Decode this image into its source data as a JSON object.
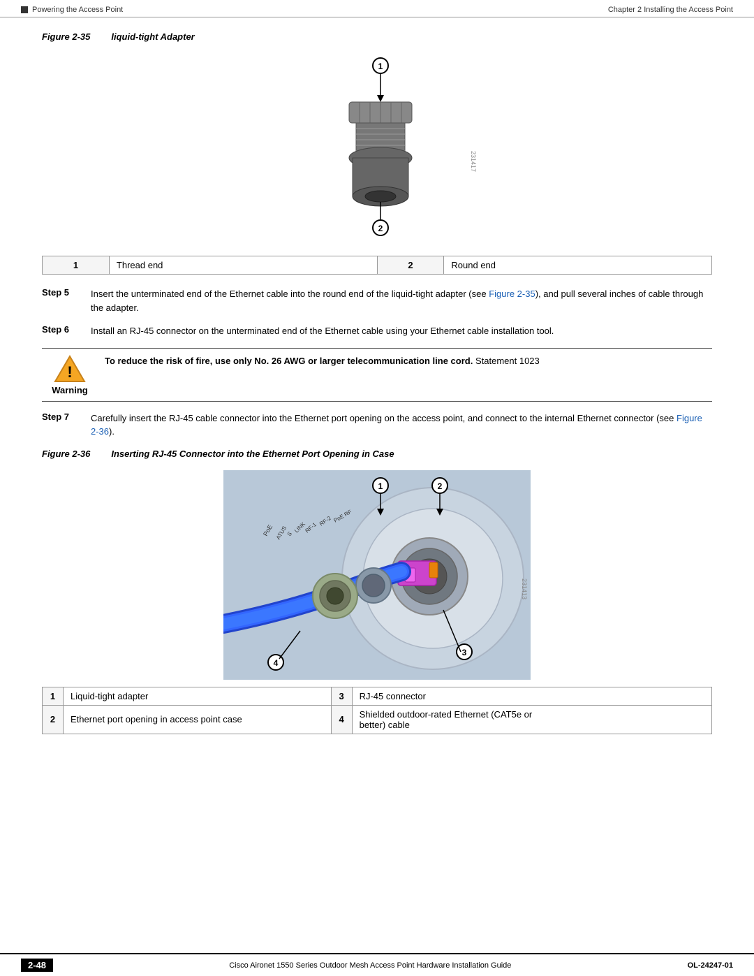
{
  "header": {
    "right_text": "Chapter 2    Installing the Access Point",
    "left_section": "Powering the Access Point"
  },
  "figure35": {
    "label": "Figure 2-35",
    "title": "liquid-tight Adapter",
    "callout1": "1",
    "callout2": "2",
    "fig_number": "231417"
  },
  "parts_table_1": {
    "items": [
      {
        "num": "1",
        "label": "Thread end"
      },
      {
        "num": "2",
        "label": "Round end"
      }
    ]
  },
  "steps": {
    "step5_label": "Step 5",
    "step5_text": "Insert the unterminated end of the Ethernet cable into the round end of the liquid-tight adapter (see Figure 2-35), and pull several inches of cable through the adapter.",
    "step5_link": "Figure 2-35",
    "step6_label": "Step 6",
    "step6_text": "Install an RJ-45 connector on the unterminated end of the Ethernet cable using your Ethernet cable installation tool.",
    "warning_label": "Warning",
    "warning_text": "To reduce the risk of fire, use only No. 26 AWG or larger telecommunication line cord.",
    "warning_statement": "Statement 1023",
    "step7_label": "Step 7",
    "step7_text": "Carefully insert the RJ-45 cable connector into the Ethernet port opening on the access point, and connect to the internal Ethernet connector (see Figure 2-36).",
    "step7_link": "Figure 2-36"
  },
  "figure36": {
    "label": "Figure 2-36",
    "title": "Inserting RJ-45 Connector into the Ethernet Port Opening in Case",
    "callout1": "1",
    "callout2": "2",
    "callout3": "3",
    "callout4": "4",
    "fig_number": "231413"
  },
  "parts_table_2": {
    "rows": [
      {
        "num": "1",
        "label": "Liquid-tight adapter",
        "num2": "3",
        "label2": "RJ-45 connector"
      },
      {
        "num": "2",
        "label": "Ethernet port opening in access point case",
        "num2": "4",
        "label2": "Shielded outdoor-rated Ethernet (CAT5e or better) cable"
      }
    ]
  },
  "footer": {
    "page_num": "2-48",
    "center_text": "Cisco Aironet 1550 Series Outdoor Mesh Access Point Hardware Installation Guide",
    "right_text": "OL-24247-01"
  }
}
